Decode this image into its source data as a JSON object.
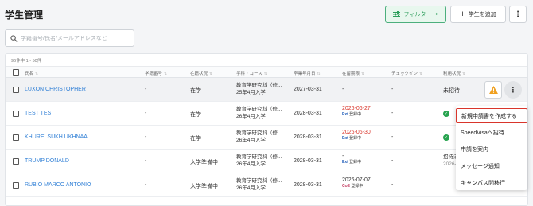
{
  "header": {
    "title": "学生管理",
    "filter_label": "フィルター",
    "filter_clear": "×",
    "add_label": "学生を追加"
  },
  "search": {
    "placeholder": "学籍番号/氏名/メールアドレスなど"
  },
  "table": {
    "count_text": "96件中 1 - 50件",
    "columns": [
      "氏名",
      "学籍番号",
      "在籍状況",
      "学科・コース",
      "卒業年月日",
      "在留期限",
      "チェックイン",
      "利用状況"
    ],
    "rows": [
      {
        "name": "LUXON CHRISTOPHER",
        "student_id": "-",
        "status": "在学",
        "course_line1": "教育学研究科（修...",
        "course_line2": "25年4月入学",
        "graduation": "2027-03-31",
        "residence_date": "-",
        "residence_tag": "",
        "residence_tag_prefix": "",
        "checkin": "-",
        "usage": "未招待"
      },
      {
        "name": "TEST TEST",
        "student_id": "-",
        "status": "在学",
        "course_line1": "教育学研究科（修...",
        "course_line2": "26年4月入学",
        "graduation": "2028-03-31",
        "residence_date": "2026-06-27",
        "residence_tag_prefix": "Ext",
        "residence_tag": "登録中",
        "checkin": "-",
        "usage": ""
      },
      {
        "name": "KHURELSUKH UKHNAA",
        "student_id": "-",
        "status": "在学",
        "course_line1": "教育学研究科（修...",
        "course_line2": "26年4月入学",
        "graduation": "2028-03-31",
        "residence_date": "2026-06-30",
        "residence_tag_prefix": "Ext",
        "residence_tag": "登録中",
        "checkin": "-",
        "usage": ""
      },
      {
        "name": "TRUMP DONALD",
        "student_id": "-",
        "status": "入学準備中",
        "course_line1": "教育学研究科（修...",
        "course_line2": "26年4月入学",
        "graduation": "2028-03-31",
        "residence_date": "-",
        "residence_tag_prefix": "Ext",
        "residence_tag": "登録中",
        "checkin": "-",
        "usage": "招待済",
        "usage_sub": "2026-..."
      },
      {
        "name": "RUBIO MARCO ANTONIO",
        "student_id": "-",
        "status": "入学準備中",
        "course_line1": "教育学研究科（修...",
        "course_line2": "26年4月入学",
        "graduation": "2028-03-31",
        "residence_date": "2026-07-07",
        "residence_tag_prefix": "CoE",
        "residence_tag": "登録中",
        "checkin": "-",
        "usage": ""
      }
    ]
  },
  "menu": {
    "items": [
      "新規申請書を作成する",
      "SpeedVisaへ招待",
      "申請を案内",
      "メッセージ通知",
      "キャンパス間移行"
    ]
  },
  "colors": {
    "accent_green": "#2e9e5c",
    "link_blue": "#2f7fd6",
    "alert_red": "#d9352b",
    "warning_orange": "#f0a020"
  }
}
